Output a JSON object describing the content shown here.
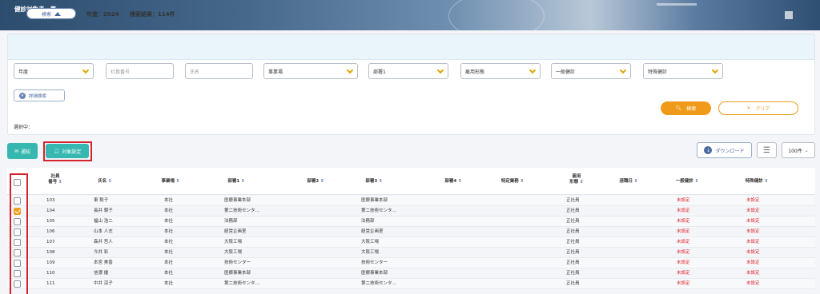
{
  "header": {
    "title": "健診対象者一覧"
  },
  "search": {
    "toggle_label": "検索",
    "year_text": "年度：2024",
    "result_text": "検索結果：114件",
    "filters": [
      {
        "label": "年度",
        "dropdown": true
      },
      {
        "label": "社員番号",
        "dropdown": false
      },
      {
        "label": "氏名",
        "dropdown": false
      },
      {
        "label": "事業場",
        "dropdown": true
      },
      {
        "label": "部署1",
        "dropdown": true
      },
      {
        "label": "雇用形態",
        "dropdown": true
      },
      {
        "label": "一般健診",
        "dropdown": true
      },
      {
        "label": "特殊健診",
        "dropdown": true
      }
    ],
    "advanced_label": "詳細検索",
    "search_button": "検索",
    "clear_button": "クリア",
    "selected_label": "選択中："
  },
  "toolbar": {
    "notify_label": "通知",
    "target_label": "対象設定",
    "download_label": "ダウンロード",
    "per_page": "100件"
  },
  "table": {
    "headers": [
      "社員\n番号",
      "氏名",
      "事業場",
      "部署1",
      "部署2",
      "部署3",
      "部署4",
      "特定業務",
      "雇用\n形態",
      "退職日",
      "一般健診",
      "特殊健診"
    ],
    "rows": [
      {
        "checked": false,
        "no": "103",
        "name": "東 聡子",
        "site": "本社",
        "dept1": "医療事業本部",
        "dept3": "医療事業本部",
        "emp": "正社員",
        "general": "未設定",
        "special": "未設定"
      },
      {
        "checked": true,
        "no": "104",
        "name": "長井 朝子",
        "site": "本社",
        "dept1": "第二技術センタ…",
        "dept3": "第二技術センタ…",
        "emp": "正社員",
        "general": "未設定",
        "special": "未設定"
      },
      {
        "checked": false,
        "no": "105",
        "name": "福山 浩二",
        "site": "本社",
        "dept1": "法務部",
        "dept3": "法務部",
        "emp": "正社員",
        "general": "未設定",
        "special": "未設定"
      },
      {
        "checked": false,
        "no": "106",
        "name": "山本 人志",
        "site": "本社",
        "dept1": "経営企画室",
        "dept3": "経営企画室",
        "emp": "正社員",
        "general": "未設定",
        "special": "未設定"
      },
      {
        "checked": false,
        "no": "107",
        "name": "森井 哲人",
        "site": "本社",
        "dept1": "大阪工場",
        "dept3": "大阪工場",
        "emp": "正社員",
        "general": "未設定",
        "special": "未設定"
      },
      {
        "checked": false,
        "no": "108",
        "name": "今井 彩",
        "site": "本社",
        "dept1": "大阪工場",
        "dept3": "大阪工場",
        "emp": "正社員",
        "general": "未設定",
        "special": "未設定"
      },
      {
        "checked": false,
        "no": "109",
        "name": "本宮 美香",
        "site": "本社",
        "dept1": "技術センター",
        "dept3": "技術センター",
        "emp": "正社員",
        "general": "未設定",
        "special": "未設定"
      },
      {
        "checked": false,
        "no": "110",
        "name": "信濃 優",
        "site": "本社",
        "dept1": "医療事業本部",
        "dept3": "医療事業本部",
        "emp": "正社員",
        "general": "未設定",
        "special": "未設定"
      },
      {
        "checked": false,
        "no": "111",
        "name": "中井 涼子",
        "site": "本社",
        "dept1": "第二技術センタ…",
        "dept3": "第二技術センタ…",
        "emp": "正社員",
        "general": "未設定",
        "special": "未設定"
      }
    ]
  }
}
